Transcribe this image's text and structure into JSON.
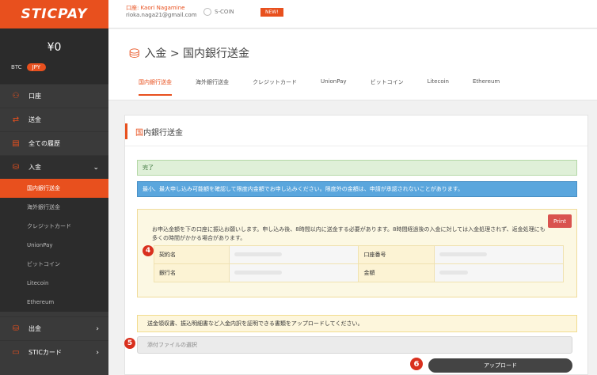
{
  "app": {
    "logo": "STICPAY"
  },
  "sidebar": {
    "balance": "¥0",
    "currencies": {
      "btc": "BTC",
      "jpy": "JPY"
    },
    "items": [
      {
        "label": "口座",
        "icon": "bank-icon"
      },
      {
        "label": "送金",
        "icon": "transfer-icon"
      },
      {
        "label": "全ての履歴",
        "icon": "history-icon"
      },
      {
        "label": "入金",
        "icon": "deposit-icon"
      }
    ],
    "sub_items": [
      "国内銀行送金",
      "海外銀行送金",
      "クレジットカード",
      "UnionPay",
      "ビットコイン",
      "Litecoin",
      "Ethereum"
    ],
    "bottom_items": [
      {
        "label": "出金",
        "icon": "withdraw-icon"
      },
      {
        "label": "STICカード",
        "icon": "card-icon"
      }
    ]
  },
  "topbar": {
    "user_label": "口座: Kaori Nagamine",
    "user_email": "rioka.naga21@gmail.com",
    "scoin": "S-COIN",
    "new_tag": "NEW!"
  },
  "page": {
    "title": "入金 > 国内銀行送金",
    "tabs": [
      "国内銀行送金",
      "海外銀行送金",
      "クレジットカード",
      "UnionPay",
      "ビットコイン",
      "Litecoin",
      "Ethereum"
    ]
  },
  "panel": {
    "title_first": "国",
    "title_rest": "内銀行送金",
    "success": "完了",
    "info": "最小、最大申し込み可能額を確認して限度内金額でお申し込みください。限度外の金額は、申請が承認されないことがあります。",
    "print": "Print",
    "instructions": "お申込金額を下の口座に振込お願いします。申し込み後、8時間以内に送金する必要があります。8時間経過後の入金に対しては入金処理されず、返金処理にも多くの時間がかかる場合があります。",
    "badge4": "4",
    "account": {
      "holder_label": "契約名",
      "account_no_label": "口座番号",
      "bank_label": "銀行名",
      "amount_label": "金額"
    },
    "note": "送金領収書、振込明細書など入金内訳を証明できる書類をアップロードしてください。",
    "badge5": "5",
    "file_placeholder": "添付ファイルの選択",
    "badge6": "6",
    "upload": "アップロード"
  },
  "colors": {
    "accent": "#e8501e",
    "sidebar": "#3a3a3a",
    "badge": "#d9301e"
  }
}
